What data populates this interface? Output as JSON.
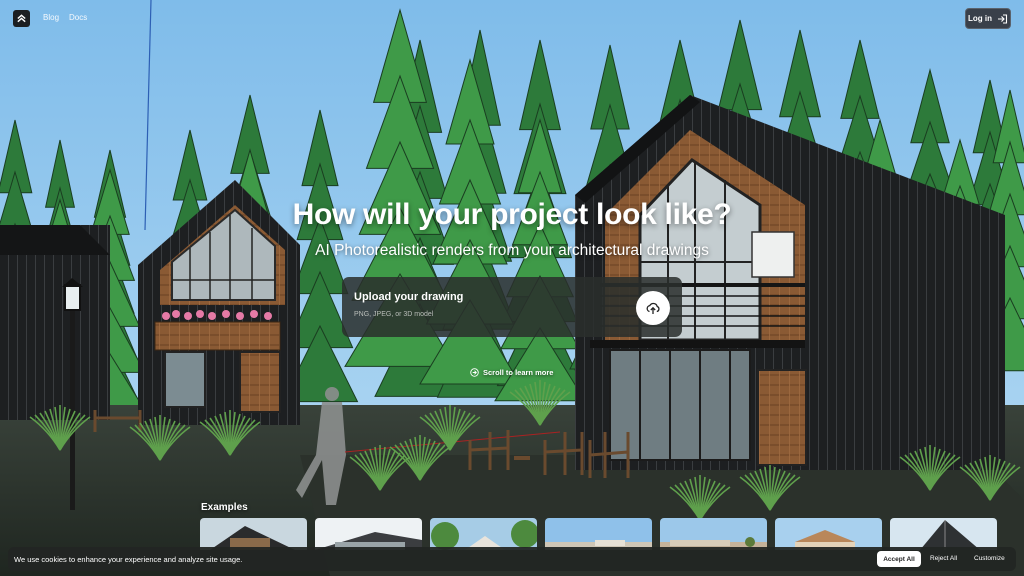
{
  "nav": {
    "logo_icon": "chevrons-up-icon",
    "links": [
      "Blog",
      "Docs"
    ],
    "login_label": "Log in",
    "login_icon": "sign-in-arrow-icon"
  },
  "hero": {
    "title": "How will your project look like?",
    "subtitle": "AI Photorealistic renders from your architectural drawings"
  },
  "upload": {
    "title": "Upload your drawing",
    "hint": "PNG, JPEG, or 3D model",
    "icon": "cloud-upload-icon"
  },
  "scroll": {
    "label": "Scroll to learn more",
    "icon": "arrow-down-circle-icon"
  },
  "examples": {
    "title": "Examples",
    "count": 7
  },
  "cookie": {
    "text": "We use cookies to enhance your experience and analyze site usage.",
    "accept": "Accept All",
    "reject": "Reject All",
    "customize": "Customize"
  },
  "colors": {
    "sky": "#8ec5ef",
    "forest": "#2f7a3c",
    "cladding": "#1d1f21",
    "wood": "#8a5a34",
    "panel": "#2a2e2c"
  }
}
